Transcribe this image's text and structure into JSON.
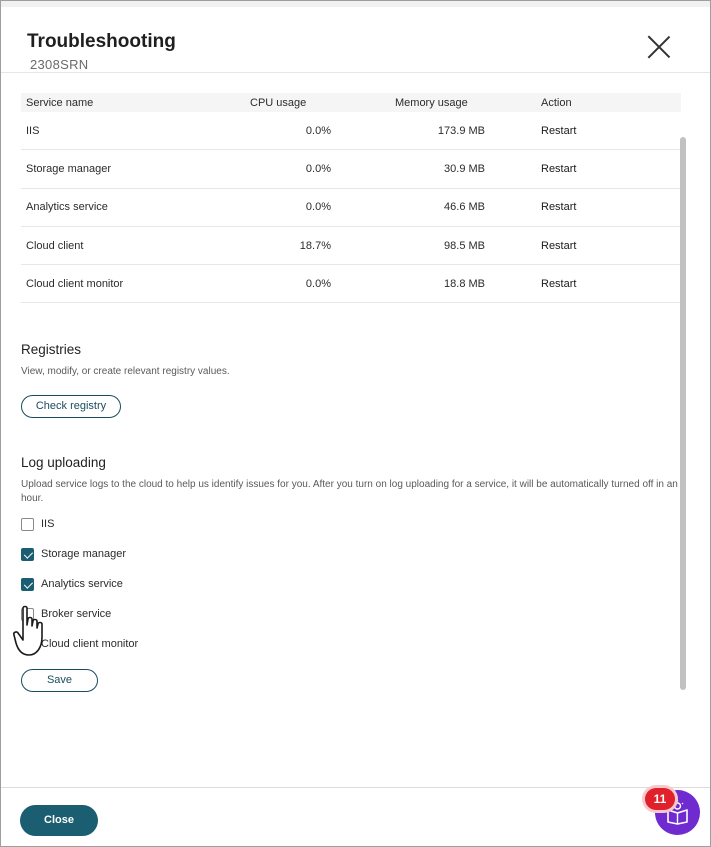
{
  "dialog": {
    "title": "Troubleshooting",
    "subtitle": "2308SRN"
  },
  "services_table": {
    "headers": {
      "name": "Service name",
      "cpu": "CPU usage",
      "memory": "Memory usage",
      "action": "Action"
    },
    "rows": [
      {
        "name": "IIS",
        "cpu": "0.0%",
        "memory": "173.9 MB",
        "action": "Restart"
      },
      {
        "name": "Storage manager",
        "cpu": "0.0%",
        "memory": "30.9 MB",
        "action": "Restart"
      },
      {
        "name": "Analytics service",
        "cpu": "0.0%",
        "memory": "46.6 MB",
        "action": "Restart"
      },
      {
        "name": "Cloud client",
        "cpu": "18.7%",
        "memory": "98.5 MB",
        "action": "Restart"
      },
      {
        "name": "Cloud client monitor",
        "cpu": "0.0%",
        "memory": "18.8 MB",
        "action": "Restart"
      }
    ]
  },
  "registries": {
    "title": "Registries",
    "description": "View, modify, or create relevant registry values.",
    "button": "Check registry"
  },
  "log_uploading": {
    "title": "Log uploading",
    "description": "Upload service logs to the cloud to help us identify issues for you. After you turn on log uploading for a service, it will be automatically turned off in an hour.",
    "options": [
      {
        "label": "IIS",
        "checked": false
      },
      {
        "label": "Storage manager",
        "checked": true
      },
      {
        "label": "Analytics service",
        "checked": true
      },
      {
        "label": "Broker service",
        "checked": false
      },
      {
        "label": "Cloud client monitor",
        "checked": false
      }
    ],
    "save_label": "Save"
  },
  "footer": {
    "close_label": "Close"
  },
  "help": {
    "badge_count": "11",
    "icon": "lightbulb-book-icon"
  },
  "colors": {
    "accent": "#1b5d71",
    "help_purple": "#6f2ad0",
    "badge_red": "#e0202a"
  }
}
